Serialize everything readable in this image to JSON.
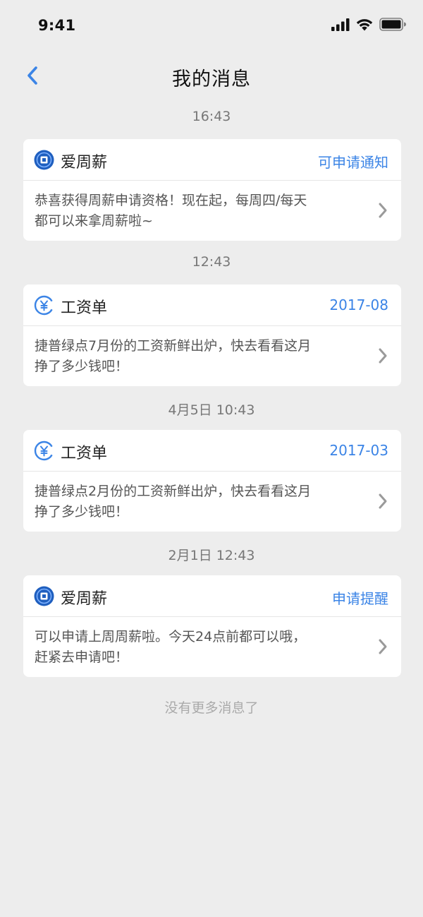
{
  "status_bar": {
    "time": "9:41",
    "icons": [
      "signal-icon",
      "wifi-icon",
      "battery-icon"
    ]
  },
  "nav": {
    "back_icon": "chevron-left-icon",
    "title": "我的消息"
  },
  "colors": {
    "accent": "#3b84e6",
    "background": "#ededed",
    "card": "#ffffff"
  },
  "messages": [
    {
      "timestamp": "16:43",
      "source": "爱周薪",
      "icon": "aizhouxin-logo-icon",
      "tag": "可申请通知",
      "text": "恭喜获得周薪申请资格！现在起，每周四/每天都可以来拿周薪啦~"
    },
    {
      "timestamp": "12:43",
      "source": "工资单",
      "icon": "yuan-icon",
      "tag": "2017-08",
      "text": "捷普绿点7月份的工资新鲜出炉，快去看看这月挣了多少钱吧！"
    },
    {
      "timestamp": "4月5日  10:43",
      "source": "工资单",
      "icon": "yuan-icon",
      "tag": "2017-03",
      "text": "捷普绿点2月份的工资新鲜出炉，快去看看这月挣了多少钱吧！"
    },
    {
      "timestamp": "2月1日  12:43",
      "source": "爱周薪",
      "icon": "aizhouxin-logo-icon",
      "tag": "申请提醒",
      "text": "可以申请上周周薪啦。今天24点前都可以哦，赶紧去申请吧！"
    }
  ],
  "footer": {
    "no_more": "没有更多消息了"
  }
}
